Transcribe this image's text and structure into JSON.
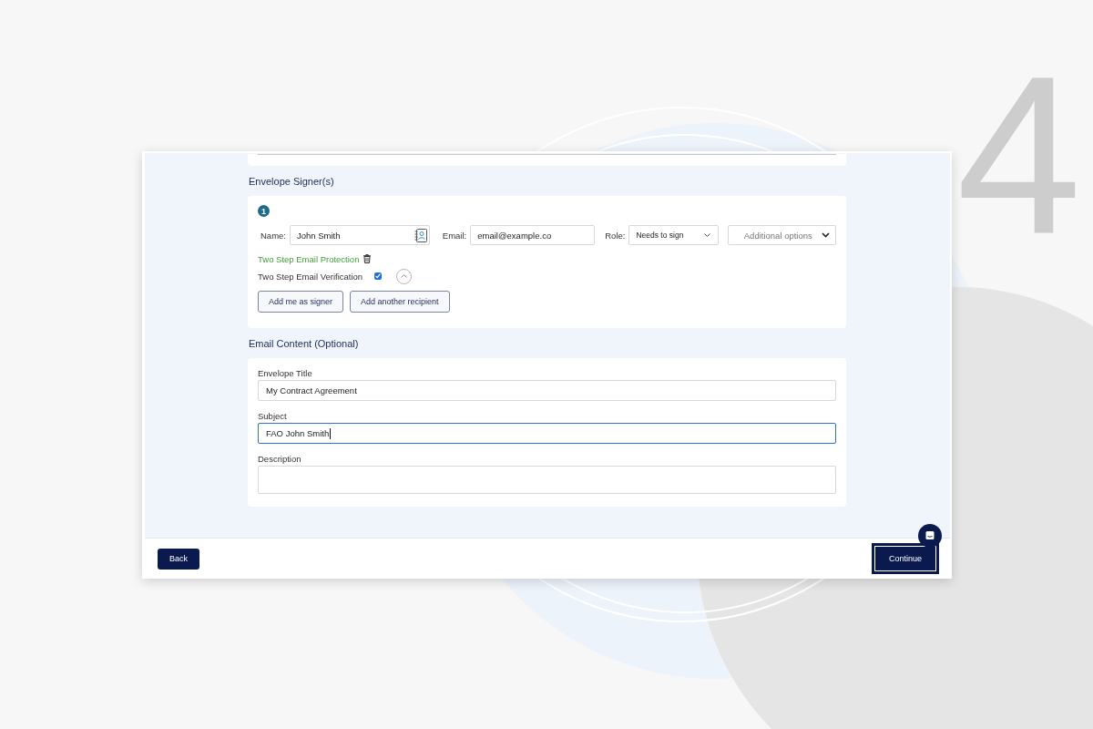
{
  "step_number": "4",
  "signers_section": {
    "heading": "Envelope Signer(s)",
    "signers": [
      {
        "number": "1",
        "name_label": "Name:",
        "name": "John Smith",
        "email_label": "Email:",
        "email": "email@example.co",
        "role_label": "Role:",
        "role": "Needs to sign",
        "options_placeholder": "Additional options",
        "protection_link": "Two Step Email Protection",
        "verification_label": "Two Step Email Verification",
        "verification_checked": true,
        "expanded": true
      }
    ],
    "buttons": [
      {
        "label": "Add me as signer"
      },
      {
        "label": "Add another recipient"
      }
    ]
  },
  "email_content": {
    "heading": "Email Content (Optional)",
    "fields": [
      {
        "kind": "input",
        "label": "Envelope Title",
        "value": "My Contract Agreement",
        "focused": false
      },
      {
        "kind": "input",
        "label": "Subject",
        "value": "FAO John Smith",
        "focused": true
      },
      {
        "kind": "textarea",
        "label": "Description",
        "focused": false
      }
    ]
  },
  "footer": {
    "buttons": [
      {
        "kind": "back",
        "label": "Back",
        "focused": false
      },
      {
        "kind": "continue",
        "label": "Continue",
        "focused": true
      }
    ]
  }
}
